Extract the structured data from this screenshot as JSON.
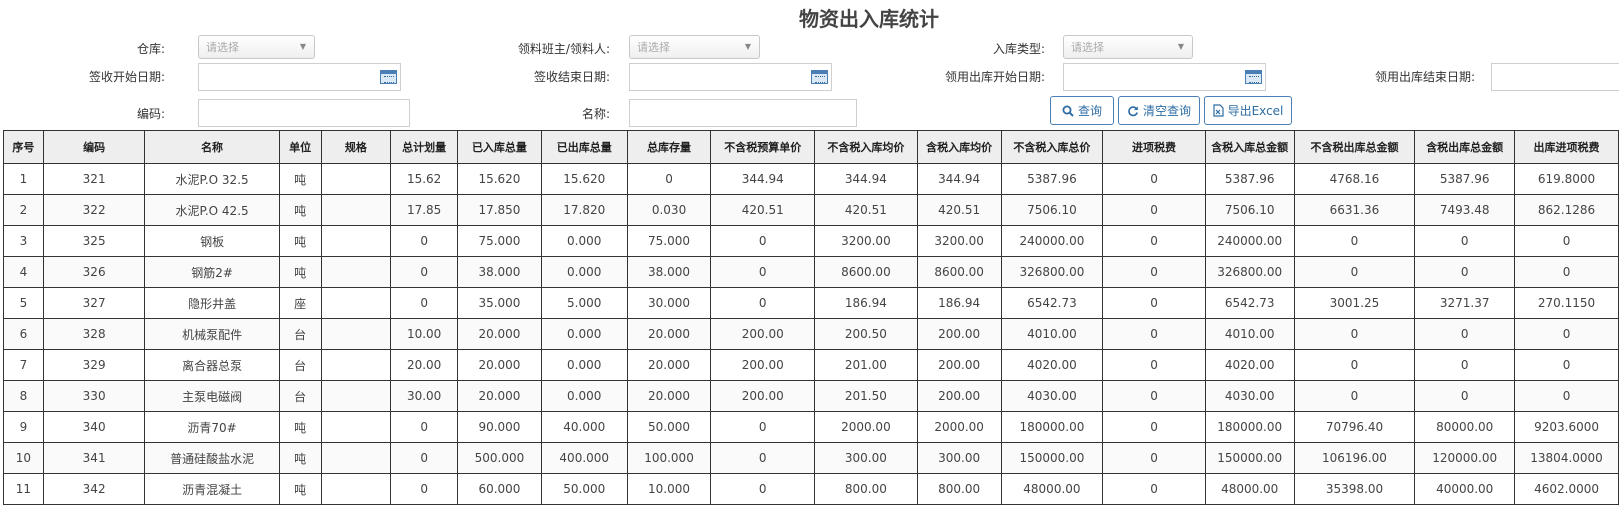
{
  "page": {
    "title": "物资出入库统计"
  },
  "filters": {
    "warehouse_label": "仓库:",
    "warehouse_value": "请选择",
    "picker_label": "领料班主/领料人:",
    "picker_value": "请选择",
    "instock_type_label": "入库类型:",
    "instock_type_value": "请选择",
    "sign_start_label": "签收开始日期:",
    "sign_end_label": "签收结束日期:",
    "out_start_label": "领用出库开始日期:",
    "out_end_label": "领用出库结束日期:",
    "code_label": "编码:",
    "name_label": "名称:"
  },
  "actions": {
    "query_label": "查询",
    "clear_label": "清空查询",
    "export_label": "导出Excel"
  },
  "table": {
    "headers": [
      "序号",
      "编码",
      "名称",
      "单位",
      "规格",
      "总计划量",
      "已入库总量",
      "已出库总量",
      "总库存量",
      "不含税预算单价",
      "不含税入库均价",
      "含税入库均价",
      "不含税入库总价",
      "进项税费",
      "含税入库总金额",
      "不含税出库总金额",
      "含税出库总金额",
      "出库进项税费"
    ],
    "rows": [
      [
        "1",
        "321",
        "水泥P.O 32.5",
        "吨",
        "",
        "15.62",
        "15.620",
        "15.620",
        "0",
        "344.94",
        "344.94",
        "344.94",
        "5387.96",
        "0",
        "5387.96",
        "4768.16",
        "5387.96",
        "619.8000"
      ],
      [
        "2",
        "322",
        "水泥P.O 42.5",
        "吨",
        "",
        "17.85",
        "17.850",
        "17.820",
        "0.030",
        "420.51",
        "420.51",
        "420.51",
        "7506.10",
        "0",
        "7506.10",
        "6631.36",
        "7493.48",
        "862.1286"
      ],
      [
        "3",
        "325",
        "钢板",
        "吨",
        "",
        "0",
        "75.000",
        "0.000",
        "75.000",
        "0",
        "3200.00",
        "3200.00",
        "240000.00",
        "0",
        "240000.00",
        "0",
        "0",
        "0"
      ],
      [
        "4",
        "326",
        "钢筋2#",
        "吨",
        "",
        "0",
        "38.000",
        "0.000",
        "38.000",
        "0",
        "8600.00",
        "8600.00",
        "326800.00",
        "0",
        "326800.00",
        "0",
        "0",
        "0"
      ],
      [
        "5",
        "327",
        "隐形井盖",
        "座",
        "",
        "0",
        "35.000",
        "5.000",
        "30.000",
        "0",
        "186.94",
        "186.94",
        "6542.73",
        "0",
        "6542.73",
        "3001.25",
        "3271.37",
        "270.1150"
      ],
      [
        "6",
        "328",
        "机械泵配件",
        "台",
        "",
        "10.00",
        "20.000",
        "0.000",
        "20.000",
        "200.00",
        "200.50",
        "200.00",
        "4010.00",
        "0",
        "4010.00",
        "0",
        "0",
        "0"
      ],
      [
        "7",
        "329",
        "离合器总泵",
        "台",
        "",
        "20.00",
        "20.000",
        "0.000",
        "20.000",
        "200.00",
        "201.00",
        "200.00",
        "4020.00",
        "0",
        "4020.00",
        "0",
        "0",
        "0"
      ],
      [
        "8",
        "330",
        "主泵电磁阀",
        "台",
        "",
        "30.00",
        "20.000",
        "0.000",
        "20.000",
        "200.00",
        "201.50",
        "200.00",
        "4030.00",
        "0",
        "4030.00",
        "0",
        "0",
        "0"
      ],
      [
        "9",
        "340",
        "沥青70#",
        "吨",
        "",
        "0",
        "90.000",
        "40.000",
        "50.000",
        "0",
        "2000.00",
        "2000.00",
        "180000.00",
        "0",
        "180000.00",
        "70796.40",
        "80000.00",
        "9203.6000"
      ],
      [
        "10",
        "341",
        "普通硅酸盐水泥",
        "吨",
        "",
        "0",
        "500.000",
        "400.000",
        "100.000",
        "0",
        "300.00",
        "300.00",
        "150000.00",
        "0",
        "150000.00",
        "106196.00",
        "120000.00",
        "13804.0000"
      ],
      [
        "11",
        "342",
        "沥青混凝土",
        "吨",
        "",
        "0",
        "60.000",
        "50.000",
        "10.000",
        "0",
        "800.00",
        "800.00",
        "48000.00",
        "0",
        "48000.00",
        "35398.00",
        "40000.00",
        "4602.0000"
      ]
    ]
  }
}
